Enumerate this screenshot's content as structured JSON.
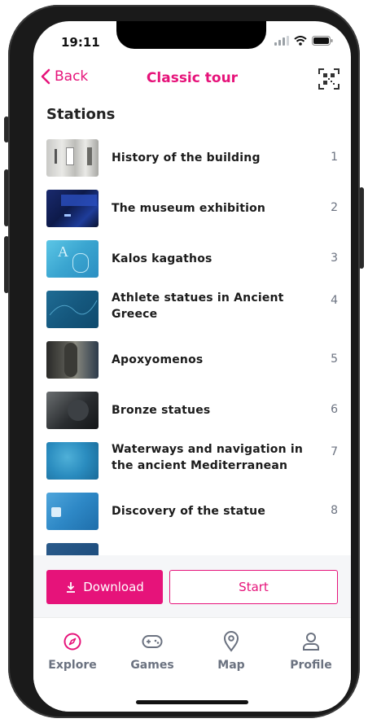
{
  "status": {
    "time": "19:11"
  },
  "header": {
    "back_label": "Back",
    "title": "Classic tour"
  },
  "section_title": "Stations",
  "stations": [
    {
      "title": "History of the building",
      "number": "1"
    },
    {
      "title": "The museum exhibition",
      "number": "2"
    },
    {
      "title": "Kalos kagathos",
      "number": "3"
    },
    {
      "title": "Athlete statues in Ancient Greece",
      "number": "4"
    },
    {
      "title": "Apoxyomenos",
      "number": "5"
    },
    {
      "title": "Bronze statues",
      "number": "6"
    },
    {
      "title": "Waterways and navigation in the ancient Mediterranean",
      "number": "7"
    },
    {
      "title": "Discovery of the statue",
      "number": "8"
    }
  ],
  "actions": {
    "download_label": "Download",
    "start_label": "Start"
  },
  "tabs": [
    {
      "label": "Explore",
      "icon": "compass-icon",
      "active": true
    },
    {
      "label": "Games",
      "icon": "gamepad-icon",
      "active": false
    },
    {
      "label": "Map",
      "icon": "map-pin-icon",
      "active": false
    },
    {
      "label": "Profile",
      "icon": "user-icon",
      "active": false
    }
  ],
  "colors": {
    "accent": "#e6137a",
    "muted": "#6b7280"
  }
}
